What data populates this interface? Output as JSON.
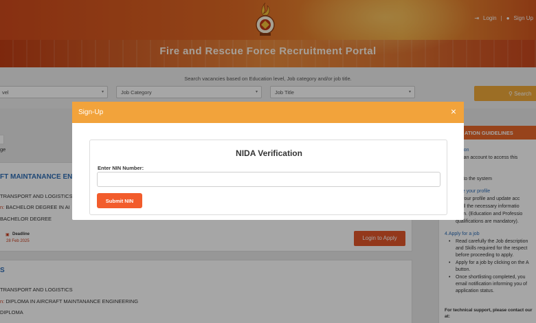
{
  "header": {
    "portal_title": "Fire and Rescue Force Recruitment Portal",
    "login_link": "Login",
    "separator": "|",
    "signup_link": "Sign Up"
  },
  "search": {
    "caption": "Search vacancies based on Education level, Job category and/or job title.",
    "education_level_select": "vel",
    "job_category_select": "Job Category",
    "job_title_select": "Job Title",
    "search_button": "Search"
  },
  "listings": [
    {
      "title": "FT MAINTANANCE ENG",
      "category": "TRANSPORT AND LOGISTICS",
      "qualification_label": "n:",
      "qualification_value": "BACHELOR DEGREE IN AI",
      "level": "BACHELOR DEGREE",
      "deadline_label": "Deadline",
      "deadline_date": "28 Feb 2025",
      "apply_button": "Login to Apply"
    },
    {
      "title": "S",
      "category": "TRANSPORT AND LOGISTICS",
      "qualification_label": "n:",
      "qualification_value": "DIPLOMA IN AIRCRAFT MAINTANANCE ENGINEERING",
      "level": "DIPLOMA"
    }
  ],
  "page_fragment": "ge",
  "guidelines": {
    "heading": "ATION GUIDELINES",
    "lines": [
      "ration",
      "ate an account to access this",
      "n into the system",
      "date your profile",
      "ck your profile and update acc",
      "in all the necessary informatio",
      "ation. (Education and Professio",
      "qualifications are mandatory).",
      "4.Apply for a job",
      "Read carefully the Job description",
      "and Skills required for the respect",
      "before proceeding to apply.",
      "Apply for a job by clicking on the A",
      "button.",
      "Once shortlisting completed, you",
      "email notification informing you of",
      "application status.",
      "For technical support, please contact our",
      "at:"
    ]
  },
  "modal": {
    "title": "Sign-Up",
    "close_symbol": "×",
    "panel_title": "NIDA Verification",
    "nin_label": "Enter NIN Number:",
    "nin_value": "",
    "nin_placeholder": "",
    "submit_button": "Submit NIN"
  },
  "colors": {
    "modal_header": "#f2a33b",
    "submit_button": "#f25c2c",
    "apply_button": "#e2572a",
    "link_blue": "#2e6db5"
  }
}
